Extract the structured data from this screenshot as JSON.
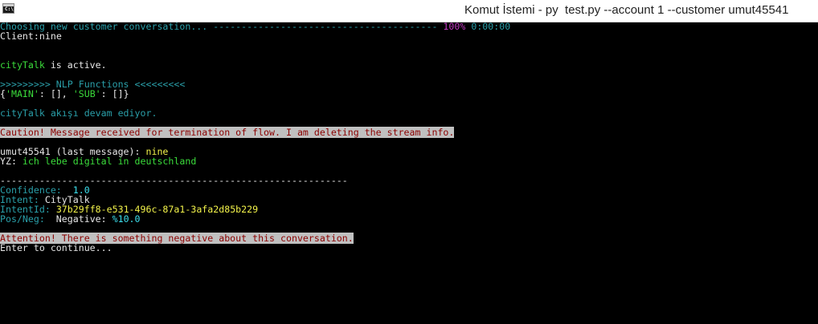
{
  "window": {
    "title": "Komut İstemi - py  test.py --account 1 --customer umut45541",
    "icon_label": "C:\\"
  },
  "console": {
    "progress": {
      "label": "Choosing new customer conversation... ",
      "bar": "----------------------------------------",
      "percent": " 100%",
      "time": " 0:00:00"
    },
    "client": {
      "label": "Client:",
      "value": "nine"
    },
    "citytalk_active": {
      "name": "cityTalk",
      "text": " is active."
    },
    "nlp_header": ">>>>>>>>> NLP Functions <<<<<<<<<",
    "nlp_dict": {
      "open": "{",
      "key1": "'MAIN'",
      "val1": ": [], ",
      "key2": "'SUB'",
      "val2": ": []",
      "close": "}"
    },
    "flow_continues": "cityTalk akışı devam ediyor.",
    "caution": "Caution! Message received for termination of flow. I am deleting the stream info.",
    "last_message": {
      "label": "umut45541 (last message): ",
      "value": "nine"
    },
    "yz": {
      "label": "YZ: ",
      "value": "ich lebe digital in deutschland"
    },
    "separator": "--------------------------------------------------------------",
    "confidence": {
      "label": "Confidence: ",
      "value": " 1.0"
    },
    "intent": {
      "label": "Intent: ",
      "value": "CityTalk"
    },
    "intent_id": {
      "label": "IntentId: ",
      "value": "37b29ff8-e531-496c-87a1-3afa2d85b229"
    },
    "pos_neg": {
      "label": "Pos/Neg: ",
      "text": " Negative: ",
      "value": "%10.0"
    },
    "attention": "Attention! There is something negative about this conversation.",
    "prompt": "Enter to continue..."
  }
}
